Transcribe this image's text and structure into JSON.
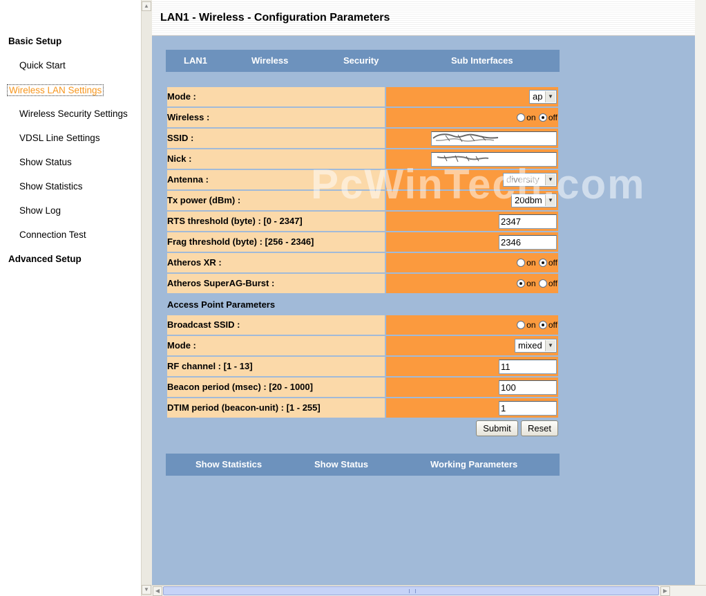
{
  "nav": {
    "basic_setup": "Basic Setup",
    "items": [
      "Quick Start",
      "Wireless LAN Settings",
      "Wireless Security Settings",
      "VDSL Line Settings",
      "Show Status",
      "Show Statistics",
      "Show Log",
      "Connection Test"
    ],
    "advanced_setup": "Advanced Setup"
  },
  "page": {
    "title": "LAN1 - Wireless - Configuration Parameters"
  },
  "tabs": [
    "LAN1",
    "Wireless",
    "Security",
    "Sub Interfaces"
  ],
  "form": {
    "mode": {
      "label": "Mode :",
      "value": "ap"
    },
    "wireless": {
      "label": "Wireless :",
      "on": "on",
      "off": "off",
      "selected": "off"
    },
    "ssid": {
      "label": "SSID :",
      "value": ""
    },
    "nick": {
      "label": "Nick :",
      "value": ""
    },
    "antenna": {
      "label": "Antenna :",
      "value": "diversity"
    },
    "txpower": {
      "label": "Tx power (dBm) :",
      "value": "20dbm"
    },
    "rts": {
      "label": "RTS threshold (byte) : [0 - 2347]",
      "value": "2347"
    },
    "frag": {
      "label": "Frag threshold (byte) : [256 - 2346]",
      "value": "2346"
    },
    "atheros_xr": {
      "label": "Atheros XR :",
      "on": "on",
      "off": "off",
      "selected": "off"
    },
    "superag": {
      "label": "Atheros SuperAG-Burst :",
      "on": "on",
      "off": "off",
      "selected": "on"
    }
  },
  "ap": {
    "title": "Access Point Parameters",
    "broadcast": {
      "label": "Broadcast SSID :",
      "on": "on",
      "off": "off",
      "selected": "off"
    },
    "mode": {
      "label": "Mode :",
      "value": "mixed"
    },
    "channel": {
      "label": "RF channel : [1 - 13]",
      "value": "11"
    },
    "beacon": {
      "label": "Beacon period (msec) : [20 - 1000]",
      "value": "100"
    },
    "dtim": {
      "label": "DTIM period (beacon-unit) : [1 - 255]",
      "value": "1"
    }
  },
  "buttons": {
    "submit": "Submit",
    "reset": "Reset"
  },
  "bottom_links": [
    "Show Statistics",
    "Show Status",
    "Working Parameters"
  ],
  "watermark": "PcWinTech.com",
  "colors": {
    "nav_active": "#f7961d",
    "tab_bar": "#6d92bd",
    "label_bg": "#fbd9a9",
    "value_bg": "#fb9a3e",
    "page_bg": "#a1bad8"
  }
}
